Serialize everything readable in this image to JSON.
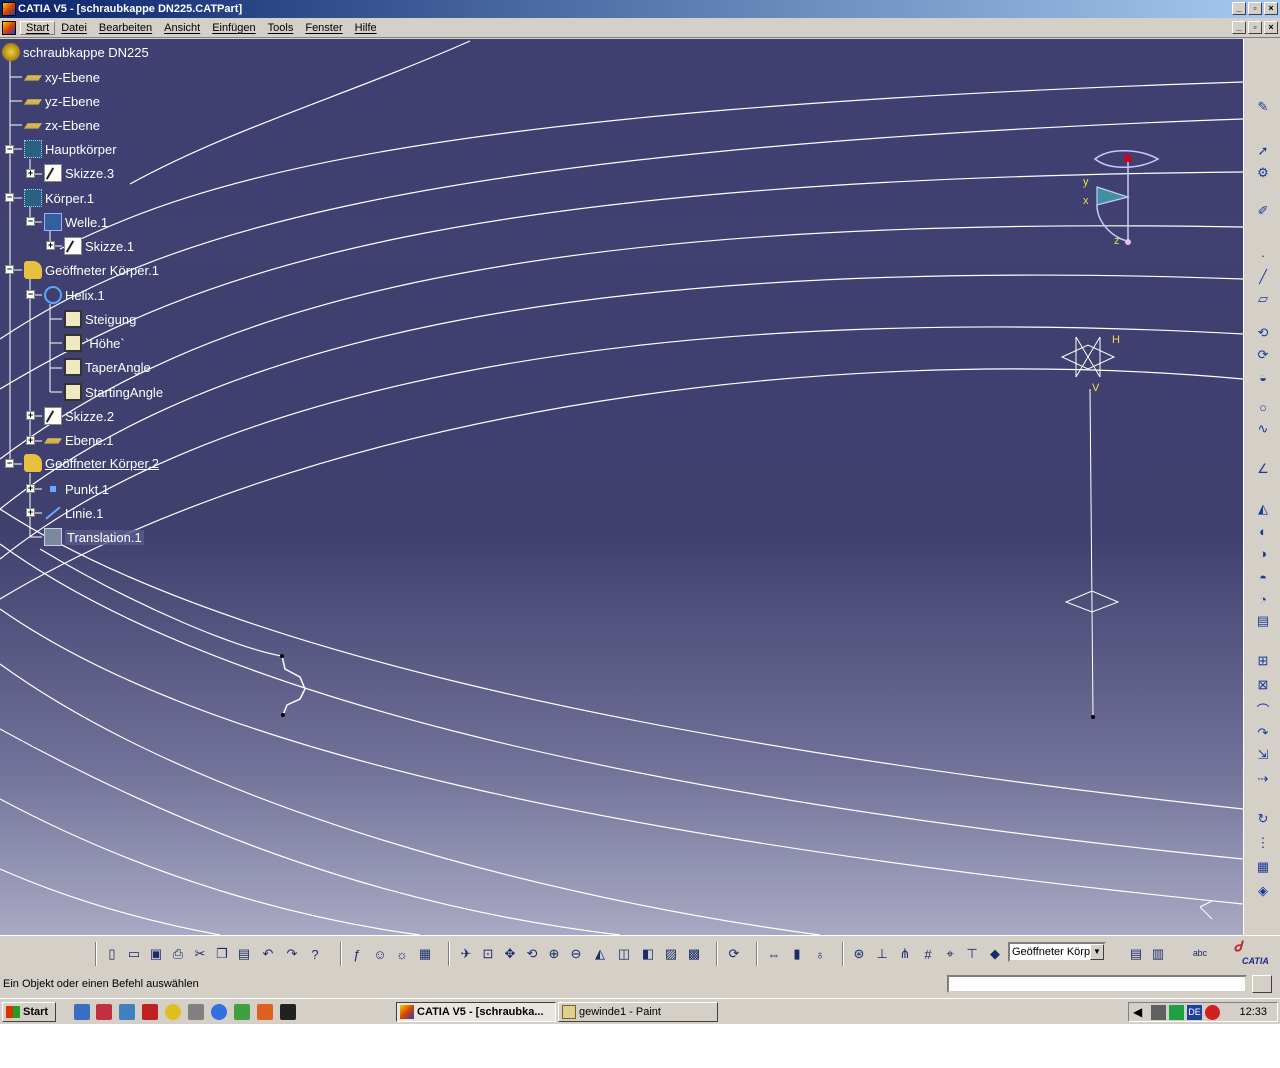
{
  "window": {
    "title": "CATIA V5 - [schraubkappe DN225.CATPart]"
  },
  "menubar": {
    "items": [
      "Start",
      "Datei",
      "Bearbeiten",
      "Ansicht",
      "Einfügen",
      "Tools",
      "Fenster",
      "Hilfe"
    ]
  },
  "tree": {
    "root": "schraubkappe DN225",
    "xy": "xy-Ebene",
    "yz": "yz-Ebene",
    "zx": "zx-Ebene",
    "hauptkoerper": "Hauptkörper",
    "skizze3": "Skizze.3",
    "koerper1": "Körper.1",
    "welle1": "Welle.1",
    "skizze1": "Skizze.1",
    "geoset1": "Geöffneter Körper.1",
    "helix1": "Helix.1",
    "steigung": "Steigung",
    "hoehe": "`Höhe`",
    "taper": "TaperAngle",
    "starting": "StartingAngle",
    "skizze2": "Skizze.2",
    "ebene1": "Ebene.1",
    "geoset2": "Geöffneter Körper.2",
    "punkt1": "Punkt.1",
    "linie1": "Linie.1",
    "translation1": "Translation.1"
  },
  "viewport": {
    "axis_labels": {
      "y": "y",
      "x": "x",
      "z": "z",
      "h": "H",
      "v": "V"
    }
  },
  "toolbar": {
    "geoset_select": "Geöffneter Körp",
    "logo": "CATIA"
  },
  "status": {
    "prompt": "Ein Objekt oder einen Befehl auswählen"
  },
  "taskbar": {
    "start": "Start",
    "tasks": [
      "CATIA V5 - [schraubka...",
      "gewinde1 - Paint"
    ],
    "tray_lang": "DE",
    "clock": "12:33"
  }
}
